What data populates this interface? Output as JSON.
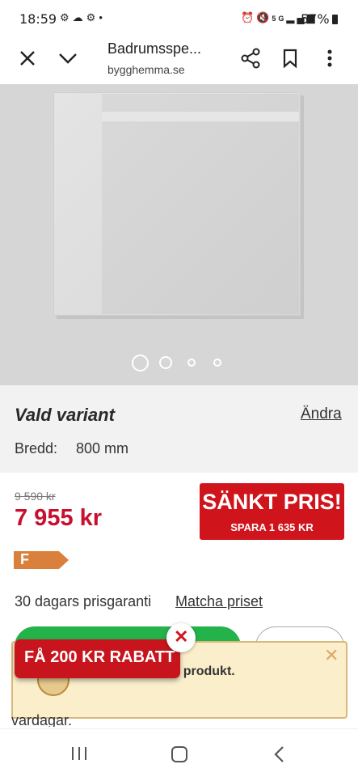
{
  "status_bar": {
    "time": "18:59",
    "battery": "57%",
    "left_icons": [
      "settings-notification-icon",
      "cloud-notification-icon",
      "settings-notification-icon",
      "dot-icon"
    ],
    "right_icons": [
      "alarm-icon",
      "mute-icon",
      "5g-icon",
      "signal-icon"
    ]
  },
  "browser": {
    "tab_title": "Badrumsspe...",
    "url": "bygghemma.se"
  },
  "gallery": {
    "dot_count": 4,
    "active_dot": 1
  },
  "variant": {
    "title": "Vald variant",
    "change_link": "Ändra",
    "width_label": "Bredd:",
    "width_value": "800 mm"
  },
  "pricing": {
    "old_price": "9 590 kr",
    "price": "7 955 kr",
    "sale_title": "SÄNKT PRIS!",
    "sale_subtitle": "SPARA 1 635 KR",
    "energy_class": "F",
    "guarantee_text": "30 dagars prisgaranti",
    "match_link": "Matcha priset"
  },
  "notice": {
    "text": "ändra på samma produkt."
  },
  "promo": {
    "label": "FÅ 200 KR RABATT"
  },
  "partial_text": "vardagar.",
  "colors": {
    "accent_red": "#d0141c",
    "price_red": "#c8102e",
    "energy_orange": "#d9803c",
    "notice_bg": "#fbeecb",
    "green": "#24b24b"
  }
}
